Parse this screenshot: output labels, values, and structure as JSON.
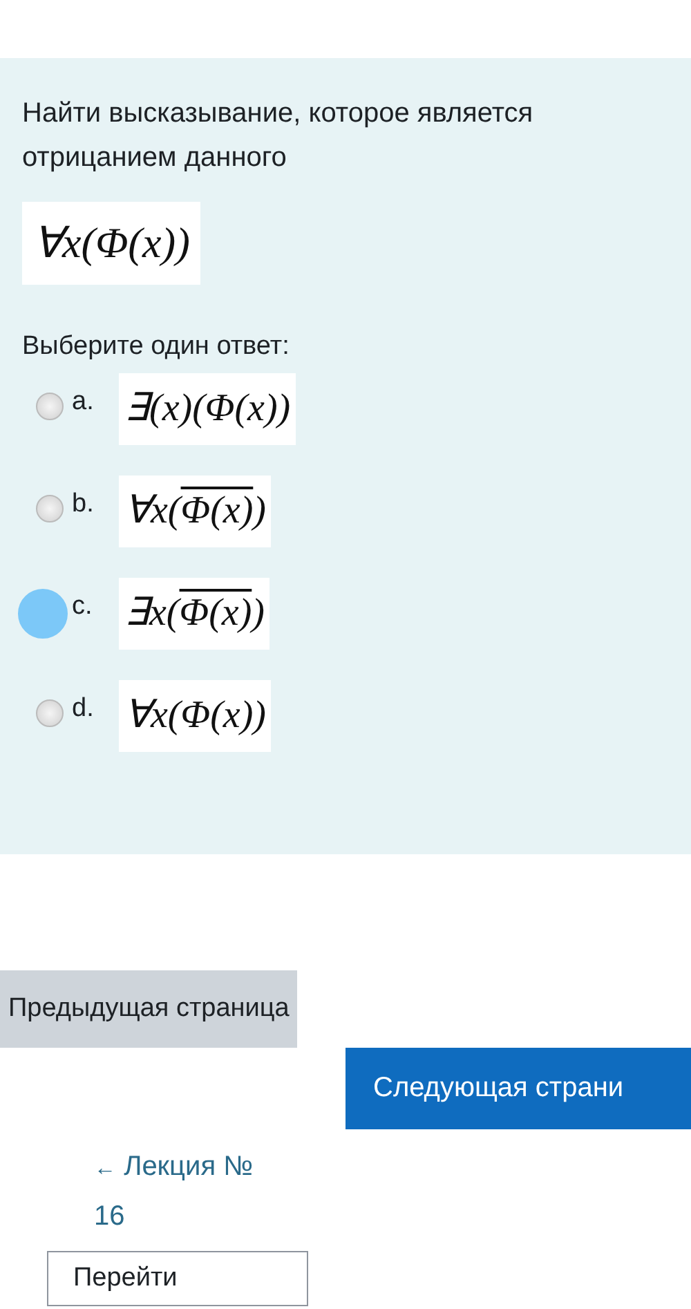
{
  "question": {
    "text": "Найти высказывание, которое является отрицанием данного",
    "formula": {
      "kind": "plain",
      "text": "∀x(Φ(x))"
    }
  },
  "prompt": "Выберите один ответ:",
  "options": [
    {
      "letter": "a.",
      "selected": false,
      "formula": {
        "kind": "plain",
        "text": "∃(x)(Φ(x))"
      }
    },
    {
      "letter": "b.",
      "selected": false,
      "formula": {
        "kind": "negated",
        "before": "∀x(",
        "negated": "Φ(x)",
        "after": ")"
      }
    },
    {
      "letter": "c.",
      "selected": true,
      "formula": {
        "kind": "negated",
        "before": "∃x(",
        "negated": "Φ(x)",
        "after": ")"
      }
    },
    {
      "letter": "d.",
      "selected": false,
      "formula": {
        "kind": "plain",
        "text": "∀x(Φ(x))"
      }
    }
  ],
  "navigation": {
    "previous": "Предыдущая страница",
    "next": "Следующая страни",
    "back_link": {
      "arrow": "←",
      "text": "Лекция № 16"
    },
    "jump_select": "Перейти"
  }
}
